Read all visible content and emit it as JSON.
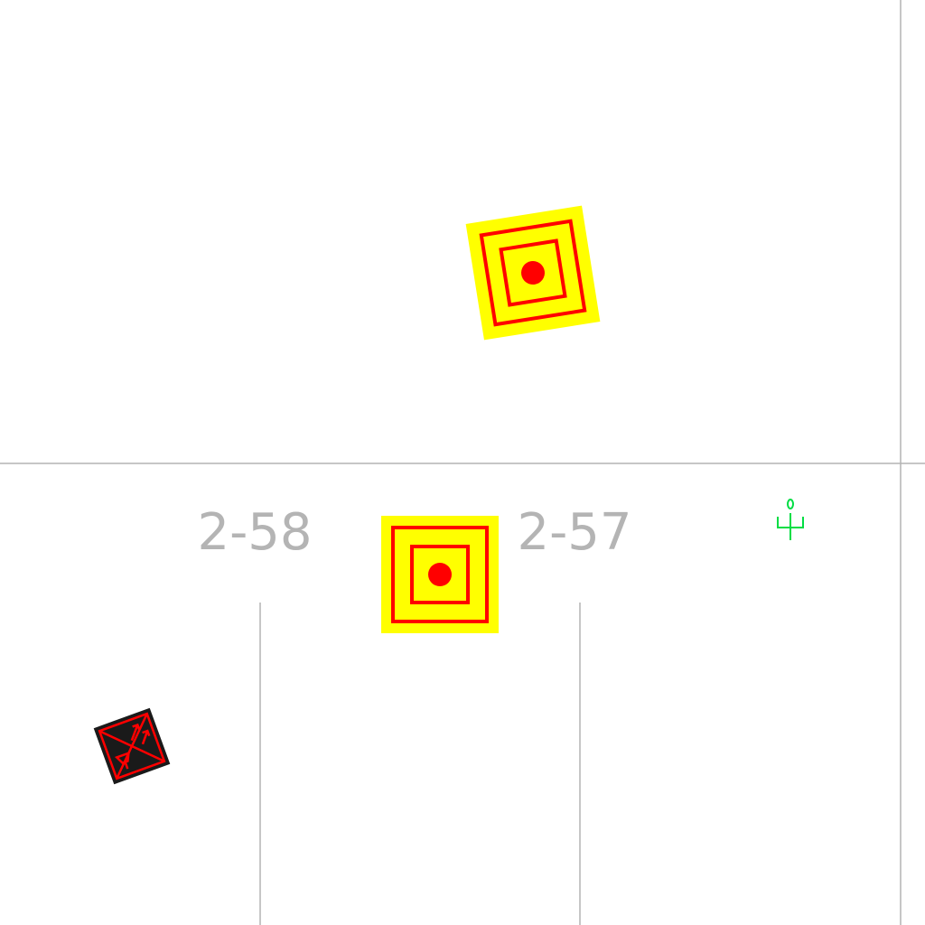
{
  "map": {
    "colors": {
      "background": "#ffffff",
      "wall_line": "#b4b4b4",
      "room_label": "#b4b4b4",
      "marker_fill": "#ffff00",
      "marker_stroke": "#ff0000",
      "equipment_fill": "#1a1a1a",
      "equipment_stroke": "#ff0000",
      "person_icon": "#00dd44"
    },
    "rooms": [
      {
        "label": "2-58"
      },
      {
        "label": "2-57"
      }
    ],
    "markers": [
      {
        "icon": "target-marker-icon"
      },
      {
        "icon": "target-marker-icon"
      }
    ],
    "equipment": [
      {
        "icon": "network-equipment-icon"
      }
    ],
    "people": [
      {
        "icon": "person-icon"
      }
    ]
  }
}
